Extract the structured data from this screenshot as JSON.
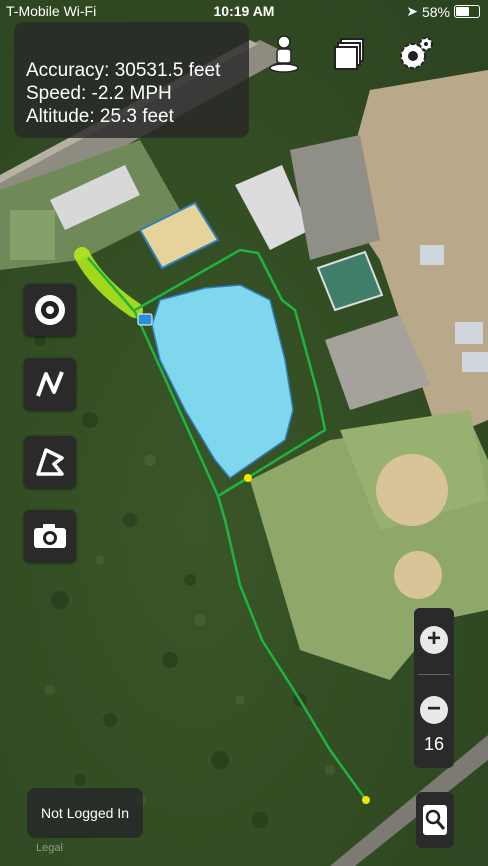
{
  "status_bar": {
    "carrier": "T-Mobile Wi-Fi",
    "time": "10:19 AM",
    "battery": "58%"
  },
  "info": {
    "accuracy": "Accuracy: 30531.5 feet",
    "speed": "Speed: -2.2 MPH",
    "altitude": "Altitude: 25.3 feet"
  },
  "toolbar": {
    "icons": [
      "person-location-icon",
      "layers-icon",
      "settings-gear-icon"
    ]
  },
  "tools": {
    "icons": [
      "waypoint-target-icon",
      "track-line-icon",
      "area-shape-icon",
      "camera-icon"
    ]
  },
  "zoom": {
    "plus": "+",
    "minus": "−",
    "level": "16"
  },
  "login": {
    "label": "Not Logged In"
  },
  "map": {
    "legal": "Legal",
    "colors": {
      "track": "#1fb341",
      "pond": "#7fd7ee",
      "highlight": "#b6f01a",
      "point": "#f2e600"
    }
  }
}
